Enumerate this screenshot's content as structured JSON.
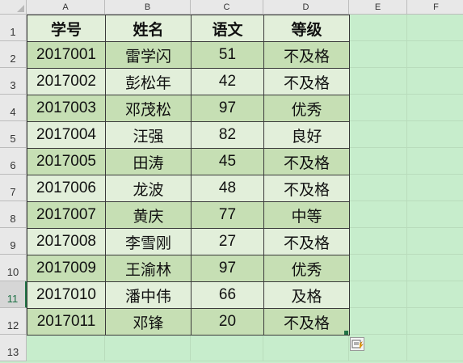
{
  "columns": [
    "A",
    "B",
    "C",
    "D",
    "E",
    "F"
  ],
  "rows": [
    "1",
    "2",
    "3",
    "4",
    "5",
    "6",
    "7",
    "8",
    "9",
    "10",
    "11",
    "12",
    "13"
  ],
  "active_row": "11",
  "table": {
    "headers": [
      "学号",
      "姓名",
      "语文",
      "等级"
    ],
    "records": [
      [
        "2017001",
        "雷学闪",
        "51",
        "不及格"
      ],
      [
        "2017002",
        "彭松年",
        "42",
        "不及格"
      ],
      [
        "2017003",
        "邓茂松",
        "97",
        "优秀"
      ],
      [
        "2017004",
        "汪强",
        "82",
        "良好"
      ],
      [
        "2017005",
        "田涛",
        "45",
        "不及格"
      ],
      [
        "2017006",
        "龙波",
        "48",
        "不及格"
      ],
      [
        "2017007",
        "黄庆",
        "77",
        "中等"
      ],
      [
        "2017008",
        "李雪刚",
        "27",
        "不及格"
      ],
      [
        "2017009",
        "王渝林",
        "97",
        "优秀"
      ],
      [
        "2017010",
        "潘中伟",
        "66",
        "及格"
      ],
      [
        "2017011",
        "邓锋",
        "20",
        "不及格"
      ]
    ]
  },
  "colors": {
    "sheet_background": "#c7edcc",
    "band_dark": "#c6dfb4",
    "band_light": "#e2efda",
    "border": "#3a3a3a"
  }
}
